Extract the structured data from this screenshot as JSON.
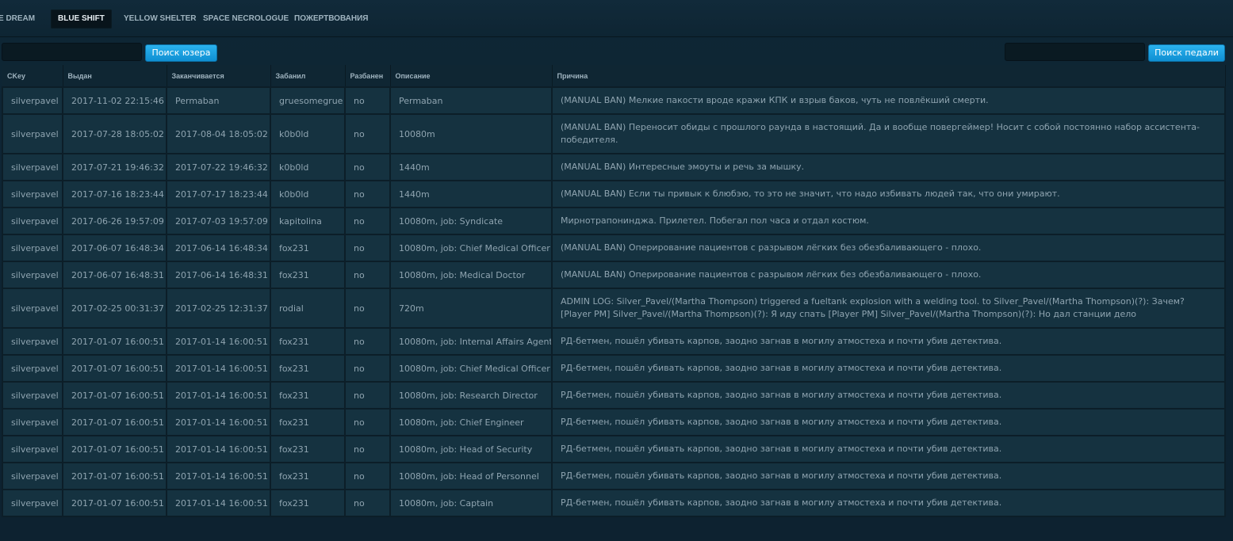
{
  "nav": {
    "items": [
      {
        "label": "E DREAM"
      },
      {
        "label": "BLUE SHIFT"
      },
      {
        "label": "YELLOW SHELTER"
      },
      {
        "label": "SPACE NECROLOGUE"
      },
      {
        "label": "ПОЖЕРТВОВАНИЯ"
      }
    ],
    "active": "BLUE SHIFT"
  },
  "search": {
    "user_input_value": "",
    "user_button_label": "Поиск юзера",
    "admin_input_value": "",
    "admin_button_label": "Поиск педали"
  },
  "table": {
    "headers": [
      "CKey",
      "Выдан",
      "Заканчивается",
      "Забанил",
      "Разбанен",
      "Описание",
      "Причина"
    ],
    "rows": [
      [
        "silverpavel",
        "2017-11-02 22:15:46",
        "Permaban",
        "gruesomegrue",
        "no",
        "Permaban",
        "(MANUAL BAN) Мелкие пакости вроде кражи КПК и взрыв баков, чуть не повлёкший смерти."
      ],
      [
        "silverpavel",
        "2017-07-28 18:05:02",
        "2017-08-04 18:05:02",
        "k0b0ld",
        "no",
        "10080m",
        "(MANUAL BAN) Переносит обиды с прошлого раунда в настоящий. Да и вообще повергеймер! Носит с собой постоянно набор ассистента-победителя."
      ],
      [
        "silverpavel",
        "2017-07-21 19:46:32",
        "2017-07-22 19:46:32",
        "k0b0ld",
        "no",
        "1440m",
        "(MANUAL BAN) Интересные эмоуты и речь за мышку."
      ],
      [
        "silverpavel",
        "2017-07-16 18:23:44",
        "2017-07-17 18:23:44",
        "k0b0ld",
        "no",
        "1440m",
        "(MANUAL BAN) Если ты привык к блюбэю, то это не значит, что надо избивать людей так, что они умирают."
      ],
      [
        "silverpavel",
        "2017-06-26 19:57:09",
        "2017-07-03 19:57:09",
        "kapitolina",
        "no",
        "10080m, job: Syndicate",
        "Мирнотрапонинджа. Прилетел. Побегал пол часа и отдал костюм."
      ],
      [
        "silverpavel",
        "2017-06-07 16:48:34",
        "2017-06-14 16:48:34",
        "fox231",
        "no",
        "10080m, job: Chief Medical Officer",
        "(MANUAL BAN) Оперирование пациентов с разрывом лёгких без обезбаливающего - плохо."
      ],
      [
        "silverpavel",
        "2017-06-07 16:48:31",
        "2017-06-14 16:48:31",
        "fox231",
        "no",
        "10080m, job: Medical Doctor",
        "(MANUAL BAN) Оперирование пациентов с разрывом лёгких без обезбаливающего - плохо."
      ],
      [
        "silverpavel",
        "2017-02-25 00:31:37",
        "2017-02-25 12:31:37",
        "rodial",
        "no",
        "720m",
        "ADMIN LOG: Silver_Pavel/(Martha Thompson) triggered a fueltank explosion with a welding tool. to Silver_Pavel/(Martha Thompson)(?): Зачем? [Player PM] Silver_Pavel/(Martha Thompson)(?): Я иду спать [Player PM] Silver_Pavel/(Martha Thompson)(?): Но дал станции дело"
      ],
      [
        "silverpavel",
        "2017-01-07 16:00:51",
        "2017-01-14 16:00:51",
        "fox231",
        "no",
        "10080m, job: Internal Affairs Agent",
        "РД-бетмен, пошёл убивать карпов, заодно загнав в могилу атмостеха и почти убив детектива."
      ],
      [
        "silverpavel",
        "2017-01-07 16:00:51",
        "2017-01-14 16:00:51",
        "fox231",
        "no",
        "10080m, job: Chief Medical Officer",
        "РД-бетмен, пошёл убивать карпов, заодно загнав в могилу атмостеха и почти убив детектива."
      ],
      [
        "silverpavel",
        "2017-01-07 16:00:51",
        "2017-01-14 16:00:51",
        "fox231",
        "no",
        "10080m, job: Research Director",
        "РД-бетмен, пошёл убивать карпов, заодно загнав в могилу атмостеха и почти убив детектива."
      ],
      [
        "silverpavel",
        "2017-01-07 16:00:51",
        "2017-01-14 16:00:51",
        "fox231",
        "no",
        "10080m, job: Chief Engineer",
        "РД-бетмен, пошёл убивать карпов, заодно загнав в могилу атмостеха и почти убив детектива."
      ],
      [
        "silverpavel",
        "2017-01-07 16:00:51",
        "2017-01-14 16:00:51",
        "fox231",
        "no",
        "10080m, job: Head of Security",
        "РД-бетмен, пошёл убивать карпов, заодно загнав в могилу атмостеха и почти убив детектива."
      ],
      [
        "silverpavel",
        "2017-01-07 16:00:51",
        "2017-01-14 16:00:51",
        "fox231",
        "no",
        "10080m, job: Head of Personnel",
        "РД-бетмен, пошёл убивать карпов, заодно загнав в могилу атмостеха и почти убив детектива."
      ],
      [
        "silverpavel",
        "2017-01-07 16:00:51",
        "2017-01-14 16:00:51",
        "fox231",
        "no",
        "10080m, job: Captain",
        "РД-бетмен, пошёл убивать карпов, заодно загнав в могилу атмостеха и почти убив детектива."
      ]
    ]
  },
  "colors": {
    "accent": "#1ea4e4",
    "background": "#0f2430",
    "row": "#153240",
    "text": "#8fa4b0"
  }
}
